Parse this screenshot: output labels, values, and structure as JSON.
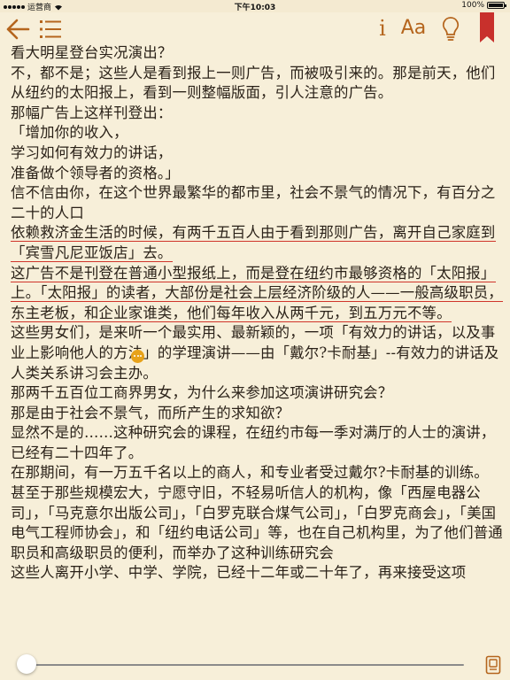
{
  "statusbar": {
    "carrier": "运营商",
    "time": "下午10:03",
    "battery": "100%"
  },
  "toolbar": {
    "info_label": "i",
    "font_label": "Aa"
  },
  "content": {
    "paragraphs": [
      "看大明星登台实况演出？",
      "不，都不是；这些人是看到报上一则广告，而被吸引来的。那是前天，他们从纽约的太阳报上，看到一则整幅版面，引人注意的广告。",
      "那幅广告上这样刊登出：",
      "「增加你的收入，",
      "学习如何有效力的讲话，",
      "准备做个领导者的资格。」",
      "信不信由你，在这个世界最繁华的都市里，社会不景气的情况下，有百分之二十的人口",
      "依赖救济金生活的时候，有两千五百人由于看到那则广告，离开自己家庭到「宾雪凡尼亚饭店」去。",
      "这广告不是刊登在普通小型报纸上，而是登在纽约市最够资格的「太阳报」上。「太阳报」的读者，大部份是社会上层经济阶级的人——一般高级职员，东主老板，和企业家谁类，他们每年收入从两千元，到五万元不等。",
      "这些男女们，是来听一个最实用、最新颖的，一项「有效力的讲话，以及事业上影响他人的方法」的学理演讲——由「戴尔?卡耐基」--有效力的讲话及人类关系讲习会主办。",
      "那两千五百位工商界男女，为什么来参加这项演讲研究会？",
      "那是由于社会不景气，而所产生的求知欲？",
      "显然不是的……这种研究会的课程，在纽约市每一季对满厅的人士的演讲，已经有二十四年了。",
      "在那期间，有一万五千名以上的商人，和专业者受过戴尔?卡耐基的训练。甚至于那些规模宏大，宁愿守旧，不轻易听信人的机构，像「西屋电器公司」，「马克意尔出版公司」，「白罗克联合煤气公司」，「白罗克商会」，「美国电气工程师协会」，和「纽约电话公司」等，也在自己机构里，为了他们普通职员和高级职员的便利，而举办了这种训练研究会",
      "这些人离开小学、中学、学院，已经十二年或二十年了，再来接受这项"
    ]
  },
  "reading_progress": 0.02,
  "colors": {
    "accent": "#b5651d",
    "bookmark": "#c8302c",
    "highlight_underline": "#d0352b",
    "note": "#e7a21a",
    "background": "#f7efd9",
    "slider": "#3478f6"
  }
}
